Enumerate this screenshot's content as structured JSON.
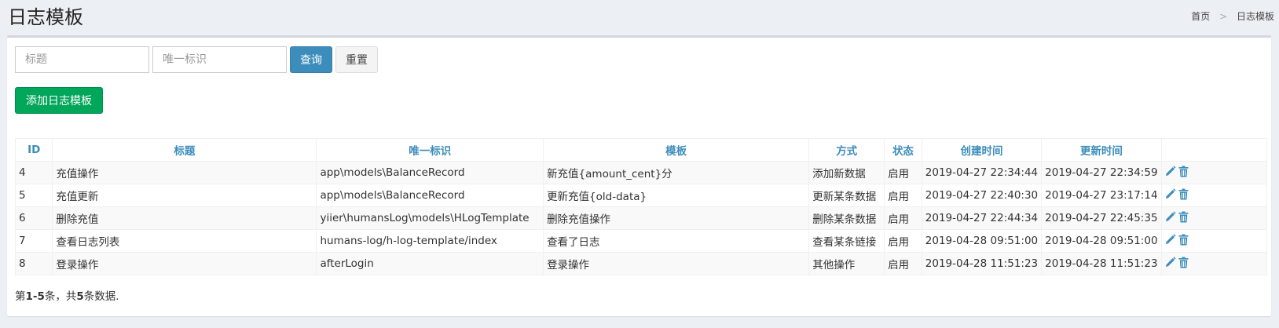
{
  "header": {
    "title": "日志模板"
  },
  "breadcrumb": {
    "home": "首页",
    "separator": ">",
    "current": "日志模板"
  },
  "search": {
    "title_placeholder": "标题",
    "key_placeholder": "唯一标识",
    "query_label": "查询",
    "reset_label": "重置"
  },
  "actions": {
    "add_label": "添加日志模板"
  },
  "table": {
    "headers": [
      "ID",
      "标题",
      "唯一标识",
      "模板",
      "方式",
      "状态",
      "创建时间",
      "更新时间",
      ""
    ],
    "rows": [
      [
        "4",
        "充值操作",
        "app\\models\\BalanceRecord",
        "新充值{amount_cent}分",
        "添加新数据",
        "启用",
        "2019-04-27 22:34:44",
        "2019-04-27 22:34:59"
      ],
      [
        "5",
        "充值更新",
        "app\\models\\BalanceRecord",
        "更新充值{old-data}",
        "更新某条数据",
        "启用",
        "2019-04-27 22:40:30",
        "2019-04-27 23:17:14"
      ],
      [
        "6",
        "删除充值",
        "yiier\\humansLog\\models\\HLogTemplate",
        "删除充值操作",
        "删除某条数据",
        "启用",
        "2019-04-27 22:44:34",
        "2019-04-27 22:45:35"
      ],
      [
        "7",
        "查看日志列表",
        "humans-log/h-log-template/index",
        "查看了日志",
        "查看某条链接",
        "启用",
        "2019-04-28 09:51:00",
        "2019-04-28 09:51:00"
      ],
      [
        "8",
        "登录操作",
        "afterLogin",
        "登录操作",
        "其他操作",
        "启用",
        "2019-04-28 11:51:23",
        "2019-04-28 11:51:23"
      ]
    ]
  },
  "summary": {
    "prefix": "第",
    "range": "1-5",
    "mid": "条，共",
    "total": "5",
    "suffix": "条数据."
  },
  "colors": {
    "accent": "#3c8dbc",
    "success": "#00a65a"
  },
  "icons": {
    "edit": "pencil-icon",
    "delete": "trash-icon"
  }
}
